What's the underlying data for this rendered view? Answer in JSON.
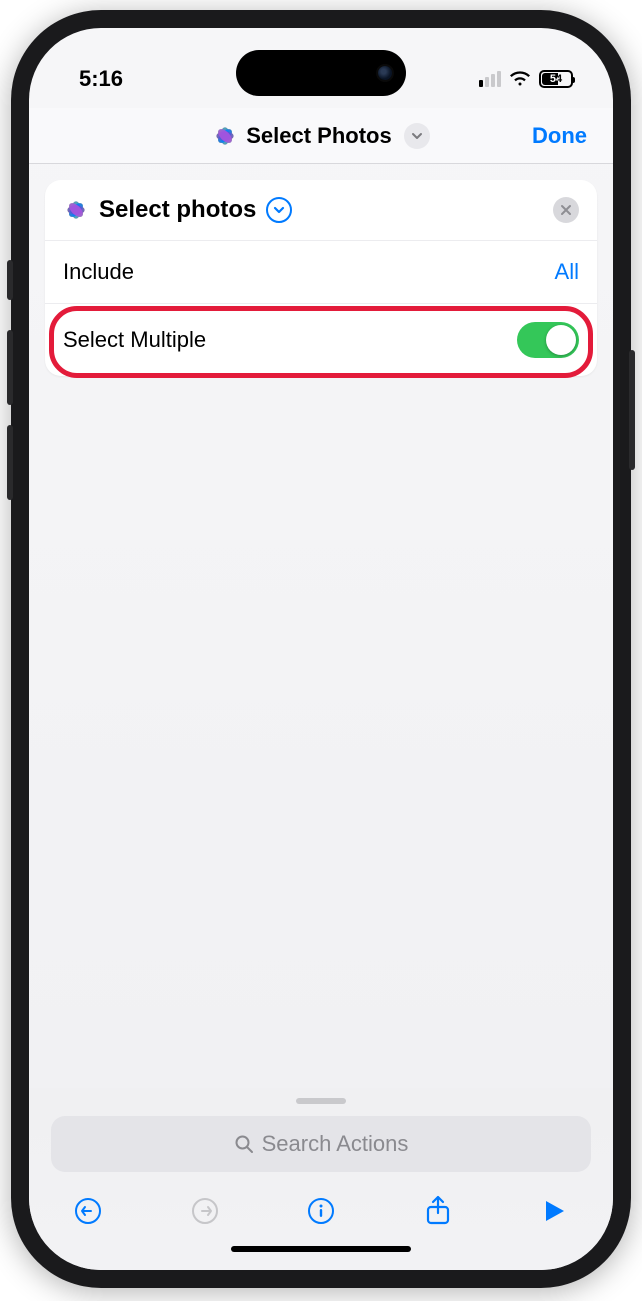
{
  "status": {
    "time": "5:16",
    "battery_level": "54"
  },
  "nav": {
    "title": "Select Photos",
    "done": "Done"
  },
  "action_card": {
    "title": "Select photos",
    "include_label": "Include",
    "include_value": "All",
    "select_multiple_label": "Select Multiple",
    "select_multiple_on": true
  },
  "search": {
    "placeholder": "Search Actions"
  },
  "colors": {
    "accent": "#007aff",
    "toggle_on": "#34c759",
    "highlight": "#e31b3a"
  }
}
